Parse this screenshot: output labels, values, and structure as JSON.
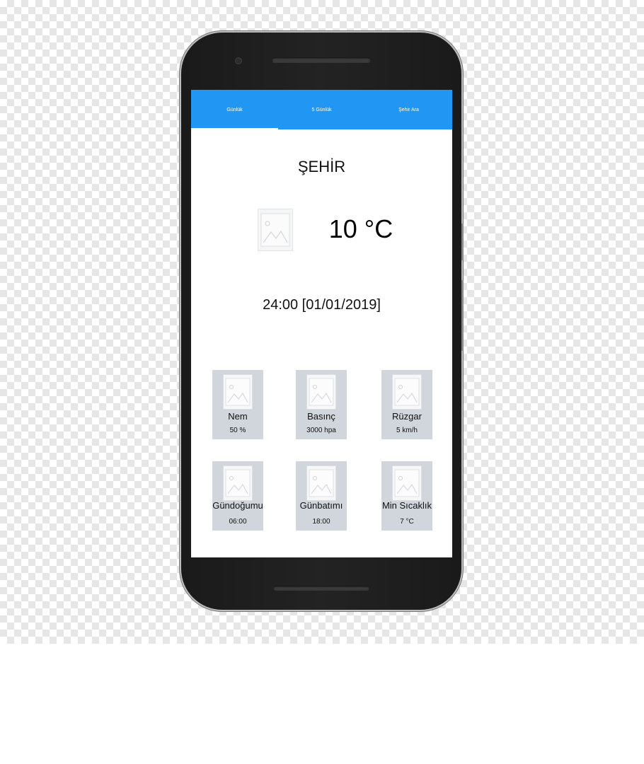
{
  "tabs": [
    {
      "label": "Günlük",
      "active": true
    },
    {
      "label": "5 Günlük",
      "active": false
    },
    {
      "label": "Şehir Ara",
      "active": false
    }
  ],
  "current": {
    "city": "ŞEHİR",
    "temperature": "10 °C",
    "datetime": "24:00 [01/01/2019]",
    "icon": "image-placeholder-icon"
  },
  "details": [
    {
      "label": "Nem",
      "value": "50 %",
      "icon": "image-placeholder-icon"
    },
    {
      "label": "Basınç",
      "value": "3000 hpa",
      "icon": "image-placeholder-icon"
    },
    {
      "label": "Rüzgar",
      "value": "5 km/h",
      "icon": "image-placeholder-icon"
    },
    {
      "label": "Gündoğumu",
      "value": "06:00",
      "icon": "image-placeholder-icon"
    },
    {
      "label": "Günbatımı",
      "value": "18:00",
      "icon": "image-placeholder-icon"
    },
    {
      "label": "Min Sıcaklık",
      "value": "7 °C",
      "icon": "image-placeholder-icon"
    }
  ],
  "colors": {
    "tab_bar": "#2196f3",
    "card_background": "#d1d6dc",
    "phone_body": "#1a1a1a"
  }
}
